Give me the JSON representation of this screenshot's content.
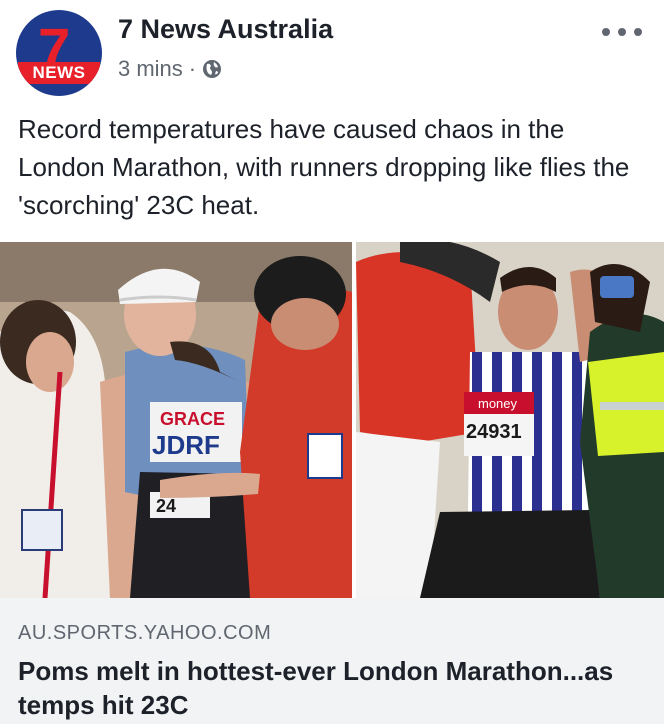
{
  "post": {
    "page_name": "7 News Australia",
    "timestamp": "3 mins",
    "separator": "·",
    "privacy_icon": "globe-icon",
    "more_icon": "more-options-icon",
    "text": "Record temperatures have caused chaos in the London Marathon, with runners dropping like flies the 'scorching' 23C heat."
  },
  "avatar": {
    "logo_number": "7",
    "logo_word": "NEWS",
    "colors": {
      "background": "#1d3a8c",
      "accent": "#e8202a"
    }
  },
  "photo": {
    "left_bib_name": "GRACE",
    "left_bib_sponsor": "JDRF",
    "left_bib_number": "24",
    "right_bib_sponsor": "money",
    "right_bib_number": "24931"
  },
  "link_preview": {
    "domain": "AU.SPORTS.YAHOO.COM",
    "title": "Poms melt in hottest-ever London Marathon...as temps hit 23C"
  }
}
